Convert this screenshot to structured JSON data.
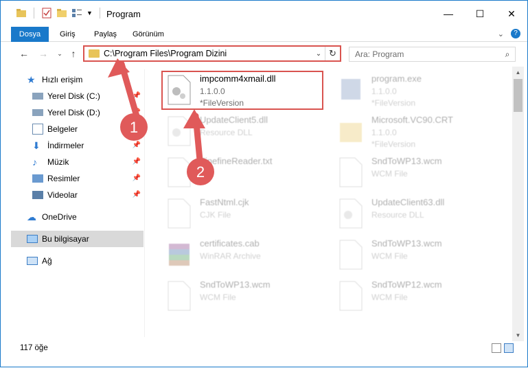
{
  "window": {
    "title": "Program"
  },
  "ribbon": {
    "tabs": [
      "Dosya",
      "Giriş",
      "Paylaş",
      "Görünüm"
    ]
  },
  "address": {
    "path": "C:\\Program Files\\Program Dizini",
    "search_placeholder": "Ara: Program"
  },
  "sidebar": {
    "items": [
      {
        "label": "Hızlı erişim",
        "icon": "star-icon"
      },
      {
        "label": "Yerel Disk (C:)",
        "icon": "drive-icon"
      },
      {
        "label": "Yerel Disk (D:)",
        "icon": "drive-icon"
      },
      {
        "label": "Belgeler",
        "icon": "documents-icon"
      },
      {
        "label": "İndirmeler",
        "icon": "download-icon"
      },
      {
        "label": "Müzik",
        "icon": "music-icon"
      },
      {
        "label": "Resimler",
        "icon": "pictures-icon"
      },
      {
        "label": "Videolar",
        "icon": "videos-icon"
      },
      {
        "label": "OneDrive",
        "icon": "cloud-icon"
      },
      {
        "label": "Bu bilgisayar",
        "icon": "computer-icon"
      },
      {
        "label": "Ağ",
        "icon": "network-icon"
      }
    ]
  },
  "files": [
    {
      "name": "impcomm4xmail.dll",
      "meta1": "1.1.0.0",
      "meta2": "*FileVersion",
      "icon": "dll-icon"
    },
    {
      "name": "program.exe",
      "meta1": "1.1.0.0",
      "meta2": "*FileVersion",
      "icon": "exe-icon"
    },
    {
      "name": "UpdateClient5.dll",
      "meta1": "Resource DLL",
      "meta2": "",
      "icon": "dll-icon"
    },
    {
      "name": "Microsoft.VC90.CRT",
      "meta1": "1.1.0.0",
      "meta2": "*FileVersion",
      "icon": "folder-icon"
    },
    {
      "name": "FinefineReader.txt",
      "meta1": "",
      "meta2": "",
      "icon": "text-file-icon"
    },
    {
      "name": "SndToWP13.wcm",
      "meta1": "WCM File",
      "meta2": "",
      "icon": "file-icon"
    },
    {
      "name": "FastNtml.cjk",
      "meta1": "CJK File",
      "meta2": "",
      "icon": "file-icon"
    },
    {
      "name": "UpdateClient63.dll",
      "meta1": "Resource DLL",
      "meta2": "",
      "icon": "dll-icon"
    },
    {
      "name": "certificates.cab",
      "meta1": "WinRAR Archive",
      "meta2": "",
      "icon": "archive-icon"
    },
    {
      "name": "SndToWP13.wcm",
      "meta1": "WCM File",
      "meta2": "",
      "icon": "file-icon"
    },
    {
      "name": "SndToWP13.wcm",
      "meta1": "WCM File",
      "meta2": "",
      "icon": "file-icon"
    },
    {
      "name": "SndToWP12.wcm",
      "meta1": "WCM File",
      "meta2": "",
      "icon": "file-icon"
    }
  ],
  "status": {
    "count": "117 öğe"
  },
  "callouts": [
    "1",
    "2"
  ],
  "colors": {
    "accent": "#1979ca",
    "callout": "#d9534f"
  }
}
